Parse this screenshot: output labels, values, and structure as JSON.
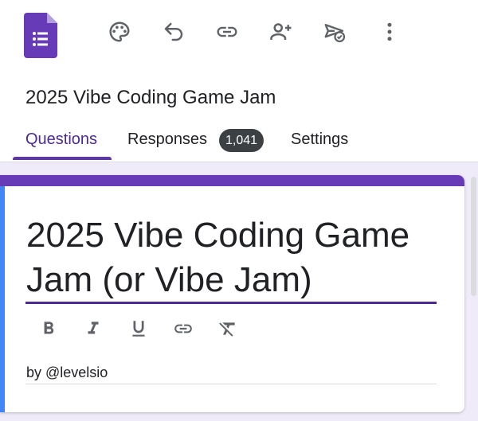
{
  "toolbar": {
    "icons": [
      "forms-logo",
      "palette-icon",
      "undo-icon",
      "link-icon",
      "add-person-icon",
      "send-icon",
      "more-vert-icon"
    ],
    "brand_color": "#673ab7",
    "icon_color": "#5f6368"
  },
  "document": {
    "name": "2025 Vibe Coding Game Jam"
  },
  "tabs": [
    {
      "label": "Questions",
      "active": true
    },
    {
      "label": "Responses",
      "badge": "1,041"
    },
    {
      "label": "Settings"
    }
  ],
  "form": {
    "title": "2025 Vibe Coding Game Jam (or Vibe Jam)",
    "description": "by @levelsio",
    "formatting": [
      "bold-icon",
      "italic-icon",
      "underline-icon",
      "link-icon",
      "clear-format-icon"
    ],
    "accent_color": "#673ab7",
    "focus_color": "#4285f4",
    "background_color": "#f0ebf8"
  }
}
